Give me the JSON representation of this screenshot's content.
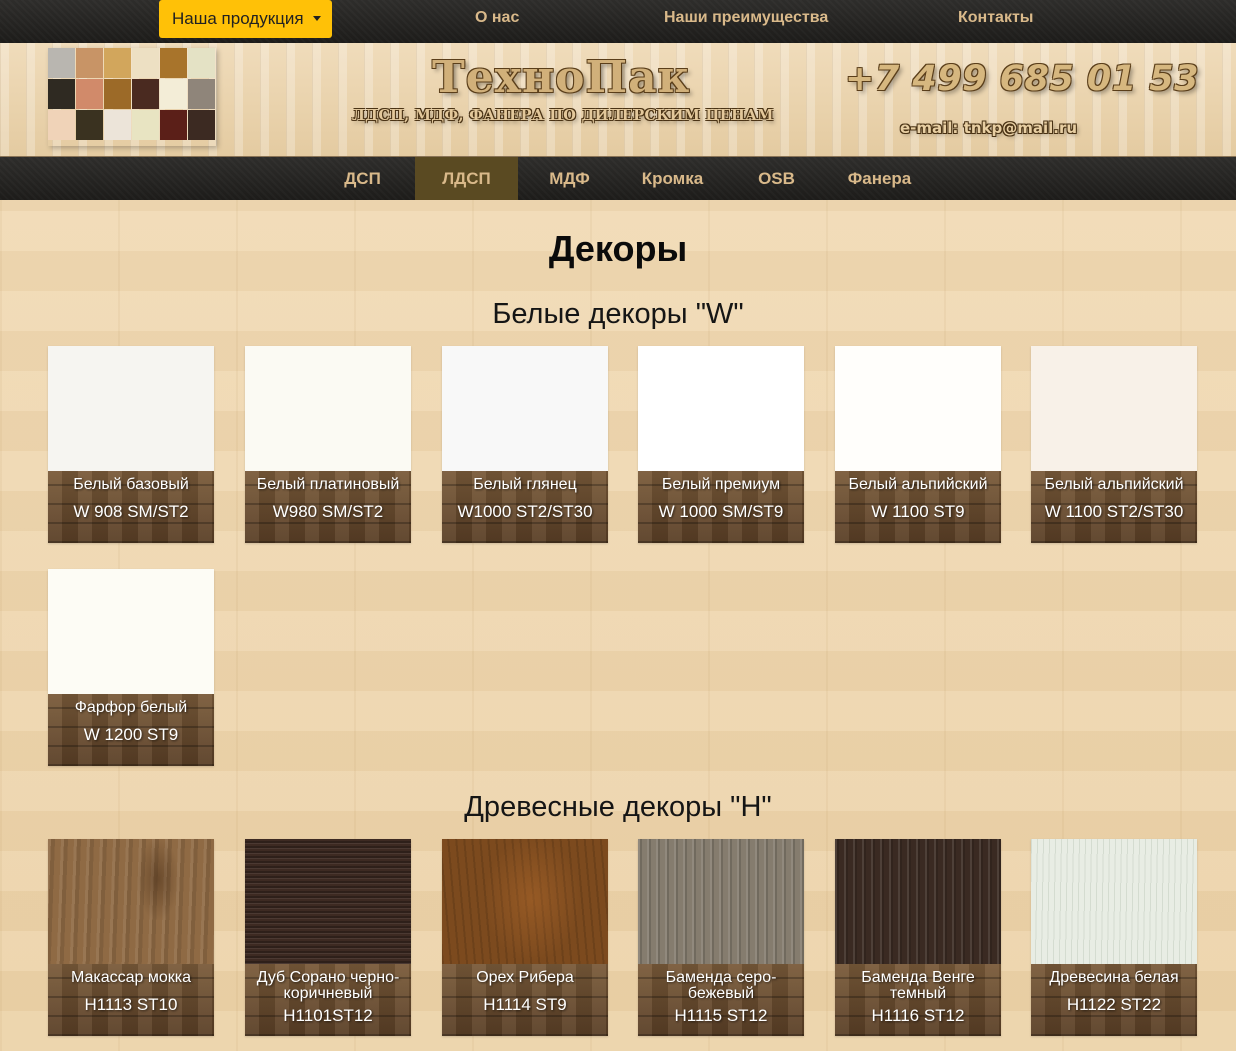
{
  "topnav": {
    "products_label": "Наша продукция",
    "about_label": "О нас",
    "advantages_label": "Наши преимущества",
    "contacts_label": "Контакты"
  },
  "header": {
    "logo": "ТехноПак",
    "tagline": "ЛДСП, МДФ, ФАНЕРА ПО ДИЛЕРСКИМ ЦЕНАМ",
    "phone": "+7 499 685 01 53",
    "email": "e-mail: tnkp@mail.ru",
    "swatch_colors": [
      "#b9b6b0",
      "#c89466",
      "#d2a65c",
      "#ede0c3",
      "#a8742b",
      "#e4e2c5",
      "#2f2a22",
      "#d18a6a",
      "#9c6a28",
      "#4a2a20",
      "#f3edd7",
      "#8f857a",
      "#f0d3b8",
      "#3a3220",
      "#ece4d9",
      "#e8e4c2",
      "#5b1f18",
      "#3c2a22"
    ]
  },
  "categories": {
    "active": "ЛДСП",
    "items": [
      "ДСП",
      "ЛДСП",
      "МДФ",
      "Кромка",
      "OSB",
      "Фанера"
    ]
  },
  "page_title": "Декоры",
  "sections": [
    {
      "title": "Белые декоры \"W\"",
      "items": [
        {
          "name": "Белый базовый",
          "code": "W 908 SM/ST2",
          "color": "#f6f5f1"
        },
        {
          "name": "Белый платиновый",
          "code": "W980 SM/ST2",
          "color": "#fbfaf3"
        },
        {
          "name": "Белый глянец",
          "code": "W1000 ST2/ST30",
          "color": "#f8f8f8"
        },
        {
          "name": "Белый премиум",
          "code": "W 1000 SM/ST9",
          "color": "#ffffff"
        },
        {
          "name": "Белый альпийский",
          "code": "W 1100 ST9",
          "color": "#fffefb"
        },
        {
          "name": "Белый альпийский",
          "code": "W 1100 ST2/ST30",
          "color": "#f8f1e8"
        },
        {
          "name": "Фарфор белый",
          "code": "W 1200 ST9",
          "color": "#fdfcf5"
        }
      ]
    },
    {
      "title": "Древесные декоры \"H\"",
      "items": [
        {
          "name": "Макассар мокка",
          "code": "H1113 ST10",
          "color": "#8f6a44"
        },
        {
          "name": "Дуб Сорано черно-коричневый",
          "code": "H1101ST12",
          "color": "#3d2a22"
        },
        {
          "name": "Орех Рибера",
          "code": "H1114 ST9",
          "color": "#7c4a1e"
        },
        {
          "name": "Баменда серо-бежевый",
          "code": "H1115 ST12",
          "color": "#857c6e"
        },
        {
          "name": "Баменда Венге темный",
          "code": "H1116 ST12",
          "color": "#3a2a22"
        },
        {
          "name": "Древесина белая",
          "code": "H1122 ST22",
          "color": "#e8ede4"
        }
      ]
    }
  ]
}
